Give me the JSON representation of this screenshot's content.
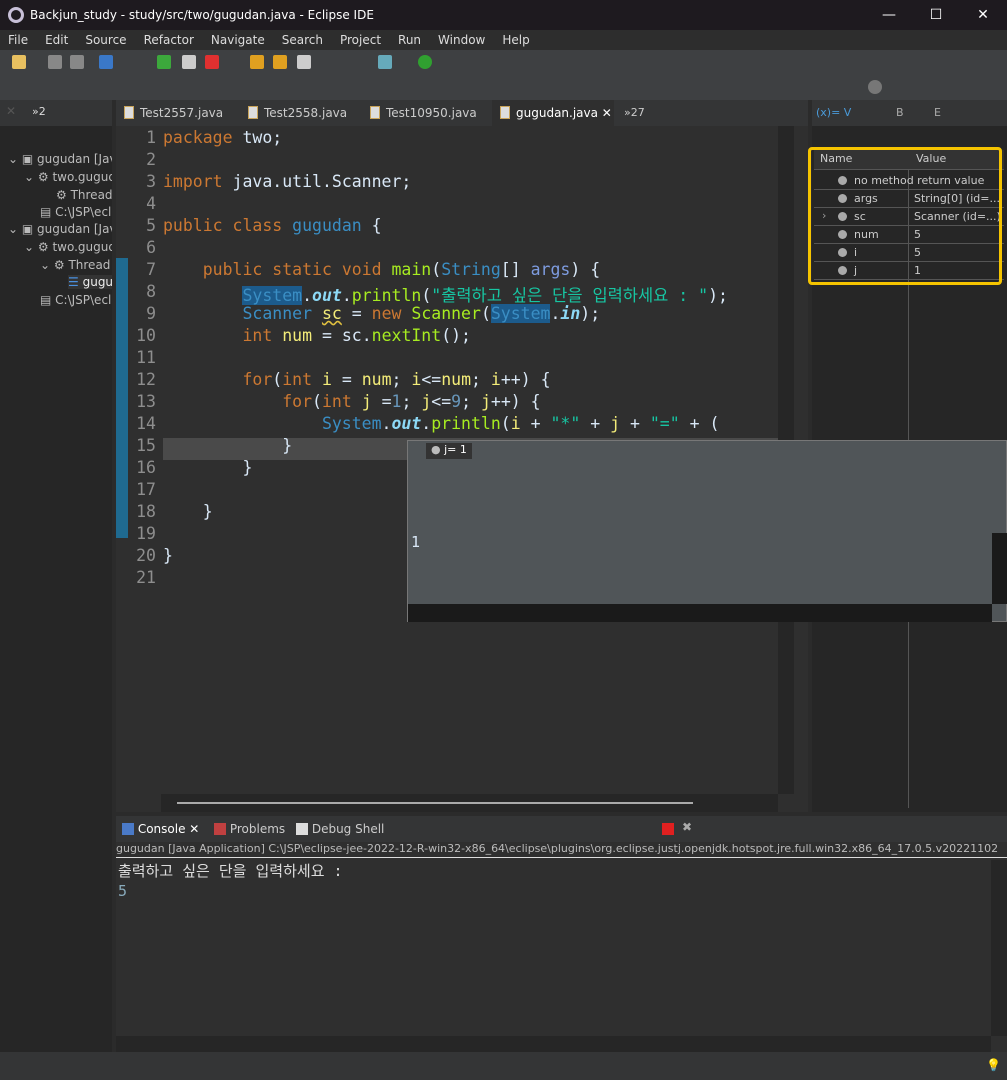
{
  "window": {
    "title": "Backjun_study - study/src/two/gugudan.java - Eclipse IDE",
    "minimize": "—",
    "maximize": "☐",
    "close": "✕"
  },
  "menu": [
    "File",
    "Edit",
    "Source",
    "Refactor",
    "Navigate",
    "Search",
    "Project",
    "Run",
    "Window",
    "Help"
  ],
  "left_panel": {
    "overflow_label": "»2",
    "tree": [
      {
        "label": "gugudan [Java Application]",
        "depth": 0
      },
      {
        "label": "two.gugudan",
        "depth": 1
      },
      {
        "label": "Thread",
        "depth": 2
      },
      {
        "label": "C:\\JSP\\eclipse",
        "depth": 1
      },
      {
        "label": "gugudan [Java Application]",
        "depth": 0
      },
      {
        "label": "two.gugudan",
        "depth": 1
      },
      {
        "label": "Thread",
        "depth": 1
      },
      {
        "label": "gugudan.main",
        "depth": 2
      },
      {
        "label": "C:\\JSP\\eclipse",
        "depth": 1
      }
    ]
  },
  "editor": {
    "tabs": [
      "Test2557.java",
      "Test2558.java",
      "Test10950.java",
      "gugudan.java"
    ],
    "overflow_label": "»27",
    "lines": [
      [
        [
          "package ",
          "kw"
        ],
        [
          "two;",
          "pl"
        ]
      ],
      [],
      [
        [
          "import ",
          "kw"
        ],
        [
          "java.util.Scanner;",
          "pl"
        ]
      ],
      [],
      [
        [
          "public ",
          "kw"
        ],
        [
          "class ",
          "kw"
        ],
        [
          "gugudan ",
          "ty"
        ],
        [
          "{",
          "pl"
        ]
      ],
      [],
      [
        [
          "    public ",
          "kw"
        ],
        [
          "static ",
          "kw"
        ],
        [
          "void ",
          "kw"
        ],
        [
          "main",
          "fn"
        ],
        [
          "(",
          "pl"
        ],
        [
          "String",
          "ty"
        ],
        [
          "[] ",
          "pl"
        ],
        [
          "args",
          "pr"
        ],
        [
          ") {",
          "pl"
        ]
      ],
      [
        [
          "        ",
          ""
        ],
        [
          "System",
          "ty sel"
        ],
        [
          ".",
          "pl"
        ],
        [
          "out",
          "fi"
        ],
        [
          ".",
          "pl"
        ],
        [
          "println",
          "fn"
        ],
        [
          "(",
          "pl"
        ],
        [
          "\"출력하고 싶은 단을 입력하세요 : \"",
          "st"
        ],
        [
          ");",
          "pl"
        ]
      ],
      [
        [
          "        Scanner ",
          "ty"
        ],
        [
          "sc",
          "var ul"
        ],
        [
          " = ",
          "pl"
        ],
        [
          "new ",
          "kw"
        ],
        [
          "Scanner",
          "fn"
        ],
        [
          "(",
          "pl"
        ],
        [
          "System",
          "ty sel"
        ],
        [
          ".",
          "pl"
        ],
        [
          "in",
          "fi"
        ],
        [
          ");",
          "pl"
        ]
      ],
      [
        [
          "        int ",
          "kw"
        ],
        [
          "num",
          "var"
        ],
        [
          " = sc.",
          "pl"
        ],
        [
          "nextInt",
          "fn"
        ],
        [
          "();",
          "pl"
        ]
      ],
      [],
      [
        [
          "        for",
          "kw"
        ],
        [
          "(",
          "pl"
        ],
        [
          "int ",
          "kw"
        ],
        [
          "i",
          "var"
        ],
        [
          " = ",
          "pl"
        ],
        [
          "num",
          "var"
        ],
        [
          "; ",
          "pl"
        ],
        [
          "i",
          "var"
        ],
        [
          "<=",
          "pl"
        ],
        [
          "num",
          "var"
        ],
        [
          "; ",
          "pl"
        ],
        [
          "i",
          "var"
        ],
        [
          "++) {",
          "pl"
        ]
      ],
      [
        [
          "            for",
          "kw"
        ],
        [
          "(",
          "pl"
        ],
        [
          "int ",
          "kw"
        ],
        [
          "j",
          "var"
        ],
        [
          " =",
          "pl"
        ],
        [
          "1",
          "num"
        ],
        [
          "; ",
          "pl"
        ],
        [
          "j",
          "var"
        ],
        [
          "<=",
          "pl"
        ],
        [
          "9",
          "num"
        ],
        [
          "; ",
          "pl"
        ],
        [
          "j",
          "var"
        ],
        [
          "++) {",
          "pl"
        ]
      ],
      [
        [
          "                System",
          "ty"
        ],
        [
          ".",
          "pl"
        ],
        [
          "out",
          "fi"
        ],
        [
          ".",
          "pl"
        ],
        [
          "println",
          "fn"
        ],
        [
          "(",
          "pl"
        ],
        [
          "i",
          "var"
        ],
        [
          " + ",
          "pl"
        ],
        [
          "\"*\"",
          "st"
        ],
        [
          " + ",
          "pl"
        ],
        [
          "j",
          "var"
        ],
        [
          " + ",
          "pl"
        ],
        [
          "\"=\"",
          "st"
        ],
        [
          " + (",
          "pl"
        ]
      ],
      [
        [
          "            }",
          "pl"
        ]
      ],
      [
        [
          "        }",
          "pl"
        ]
      ],
      [],
      [
        [
          "    }",
          "pl"
        ]
      ],
      [],
      [
        [
          "}",
          "pl"
        ]
      ],
      []
    ]
  },
  "variables": {
    "tabs": [
      "(x)= V",
      "B",
      "E"
    ],
    "headers": {
      "name": "Name",
      "value": "Value"
    },
    "rows": [
      {
        "name": "no method return value",
        "value": ""
      },
      {
        "name": "args",
        "value": "String[0]  (id=...)"
      },
      {
        "name": "sc",
        "value": "Scanner  (id=...)"
      },
      {
        "name": "num",
        "value": "5"
      },
      {
        "name": "i",
        "value": "5"
      },
      {
        "name": "j",
        "value": "1"
      }
    ],
    "highlight_color": "#f5c400"
  },
  "hover": {
    "title": "j= 1",
    "value": "1"
  },
  "console": {
    "tabs": [
      "Console",
      "Problems",
      "Debug Shell"
    ],
    "launch": "gugudan [Java Application] C:\\JSP\\eclipse-jee-2022-12-R-win32-x86_64\\eclipse\\plugins\\org.eclipse.justj.openjdk.hotspot.jre.full.win32.x86_64_17.0.5.v20221102",
    "output": [
      "출력하고 싶은 단을 입력하세요 :",
      "5"
    ]
  }
}
